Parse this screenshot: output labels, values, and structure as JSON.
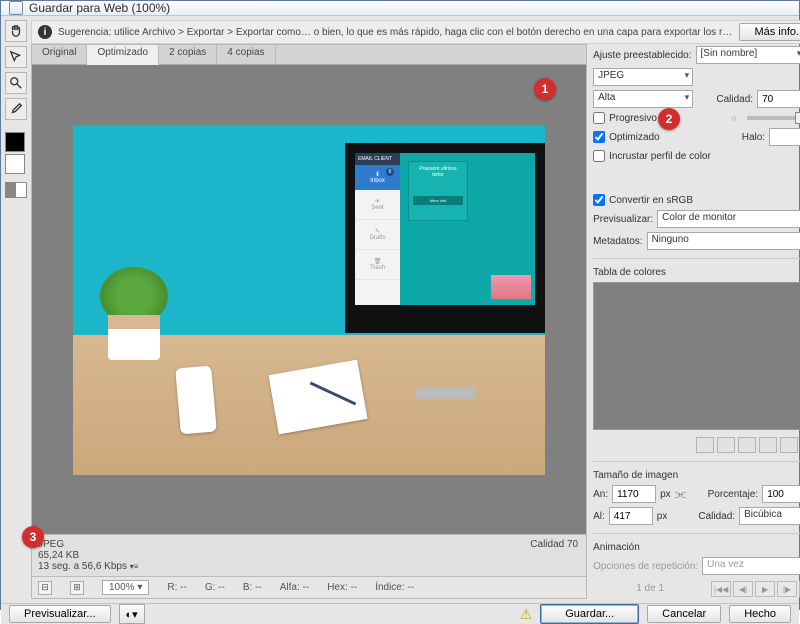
{
  "title": "Guardar para Web (100%)",
  "hint": {
    "prefix": "Sugerencia:",
    "text": "utilice Archivo > Exportar > Exportar como… o bien, lo que es más rápido, haga clic con el botón derecho en una capa para exportar los recursos",
    "more": "Más info."
  },
  "tabs": {
    "t1": "Original",
    "t2": "Optimizado",
    "t3": "2 copias",
    "t4": "4 copias"
  },
  "preview_screen": {
    "header": "EMAIL CLIENT",
    "inbox": "Inbox",
    "inbox_count": "6",
    "sent": "Sent",
    "drafts": "Drafts",
    "trash": "Trash",
    "card_title": "Praesent ultrices",
    "card_sub": "tortor",
    "card_btn": "More info"
  },
  "info": {
    "fmt": "JPEG",
    "size": "65,24 KB",
    "time": "13 seg. a 56,6 Kbps",
    "quality_lbl": "Calidad 70"
  },
  "zoom": {
    "value": "100%",
    "r": "R: --",
    "g": "G: --",
    "b": "B: --",
    "alfa": "Alfa: --",
    "hex": "Hex: --",
    "indice": "Índice: --"
  },
  "preset": {
    "label": "Ajuste preestablecido:",
    "value": "[Sin nombre]"
  },
  "format": {
    "value": "JPEG",
    "quality_mode": "Alta",
    "quality_label": "Calidad:",
    "quality_value": "70"
  },
  "opts": {
    "progresivo": "Progresivo",
    "optimizado": "Optimizado",
    "halo": "Halo:",
    "incrustar": "Incrustar perfil de color"
  },
  "color": {
    "convert": "Convertir en sRGB",
    "prev_label": "Previsualizar:",
    "prev_value": "Color de monitor",
    "meta_label": "Metadatos:",
    "meta_value": "Ninguno"
  },
  "table": {
    "label": "Tabla de colores"
  },
  "size": {
    "title": "Tamaño de imagen",
    "w_label": "An:",
    "w_value": "1170",
    "px": "px",
    "h_label": "Al:",
    "h_value": "417",
    "pct_label": "Porcentaje:",
    "pct_value": "100",
    "pct_unit": "%",
    "q_label": "Calidad:",
    "q_value": "Bicúbica"
  },
  "anim": {
    "title": "Animación",
    "rep_label": "Opciones de repetición:",
    "rep_value": "Una vez",
    "page": "1 de 1"
  },
  "footer": {
    "preview": "Previsualizar...",
    "save": "Guardar...",
    "cancel": "Cancelar",
    "done": "Hecho"
  },
  "markers": {
    "m1": "1",
    "m2": "2",
    "m3": "3"
  }
}
